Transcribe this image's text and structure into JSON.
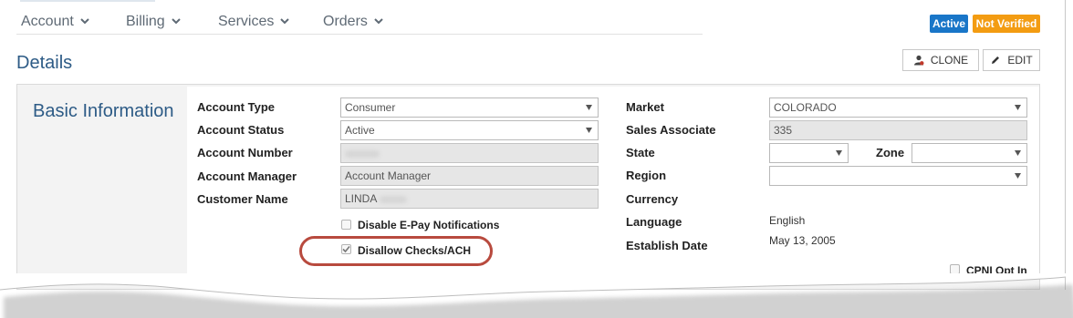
{
  "nav": {
    "items": [
      {
        "label": "Account"
      },
      {
        "label": "Billing"
      },
      {
        "label": "Services"
      },
      {
        "label": "Orders"
      }
    ],
    "badges": {
      "active": "Active",
      "not_verified": "Not Verified"
    }
  },
  "header": {
    "title": "Details",
    "clone_label": "CLONE",
    "edit_label": "EDIT"
  },
  "section": {
    "title": "Basic Information"
  },
  "left": {
    "account_type": {
      "label": "Account Type",
      "value": "Consumer"
    },
    "account_status": {
      "label": "Account Status",
      "value": "Active"
    },
    "account_number": {
      "label": "Account Number",
      "value": ""
    },
    "account_manager": {
      "label": "Account Manager",
      "value": "Account Manager"
    },
    "customer_name": {
      "label": "Customer Name",
      "value": "LINDA"
    },
    "disable_epay": {
      "label": "Disable E-Pay Notifications",
      "checked": false
    },
    "disallow_checks": {
      "label": "Disallow Checks/ACH",
      "checked": true
    }
  },
  "right": {
    "market": {
      "label": "Market",
      "value": "COLORADO"
    },
    "sales_associate": {
      "label": "Sales Associate",
      "value": "335"
    },
    "state": {
      "label": "State",
      "value": ""
    },
    "zone": {
      "label": "Zone",
      "value": ""
    },
    "region": {
      "label": "Region",
      "value": ""
    },
    "currency": {
      "label": "Currency",
      "value": ""
    },
    "language": {
      "label": "Language",
      "value": "English"
    },
    "establish_date": {
      "label": "Establish Date",
      "value": "May 13, 2005"
    },
    "cpni_opt_in": {
      "label": "CPNI Opt In",
      "checked": false
    }
  },
  "colors": {
    "accent_blue": "#1976c8",
    "warning_orange": "#f39c12",
    "title_blue": "#2d5b86",
    "highlight_red": "#b84a3e"
  }
}
